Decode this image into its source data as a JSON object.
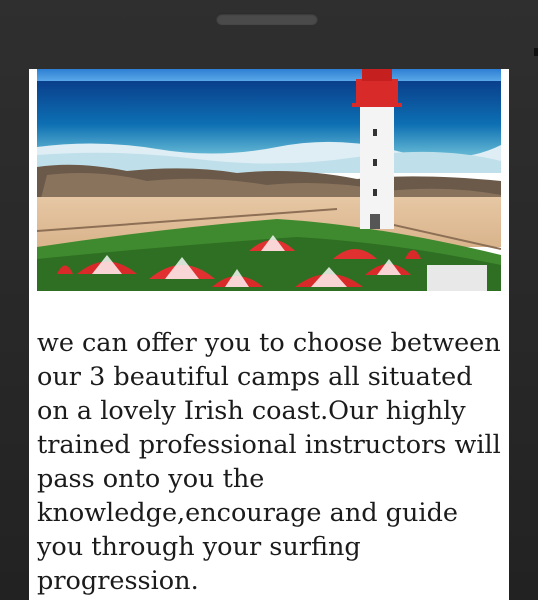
{
  "hero": {
    "alt": "Coastal lighthouse with red and white umbrellas"
  },
  "content": {
    "paragraph": "we can offer you to choose between our 3 beautiful camps all situated on a lovely Irish coast.Our highly trained professional instructors will pass onto you the knowledge,encourage and guide you through your surfing progression."
  },
  "colors": {
    "phone_frame": "#2a2a2a",
    "screen_bg": "#ffffff",
    "text": "#1b1b1b"
  }
}
